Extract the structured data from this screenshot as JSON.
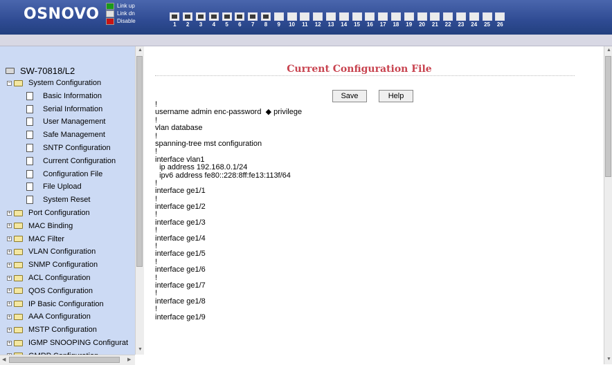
{
  "header": {
    "logo": "OSNOVO",
    "legend": [
      {
        "label": "Link up",
        "color": "#1a9a1a"
      },
      {
        "label": "Link dn",
        "color": "#e0e0e0"
      },
      {
        "label": "Disable",
        "color": "#c81414"
      }
    ],
    "ports": [
      {
        "label": "1",
        "state": "up"
      },
      {
        "label": "2",
        "state": "up"
      },
      {
        "label": "3",
        "state": "up"
      },
      {
        "label": "4",
        "state": "up"
      },
      {
        "label": "5",
        "state": "up"
      },
      {
        "label": "6",
        "state": "up"
      },
      {
        "label": "7",
        "state": "up"
      },
      {
        "label": "8",
        "state": "up"
      },
      {
        "label": "9",
        "state": "down"
      },
      {
        "label": "10",
        "state": "down"
      },
      {
        "label": "11",
        "state": "down"
      },
      {
        "label": "12",
        "state": "down"
      },
      {
        "label": "13",
        "state": "down"
      },
      {
        "label": "14",
        "state": "down"
      },
      {
        "label": "15",
        "state": "down"
      },
      {
        "label": "16",
        "state": "down"
      },
      {
        "label": "17",
        "state": "down"
      },
      {
        "label": "18",
        "state": "down"
      },
      {
        "label": "19",
        "state": "down"
      },
      {
        "label": "20",
        "state": "down"
      },
      {
        "label": "21",
        "state": "down"
      },
      {
        "label": "22",
        "state": "down"
      },
      {
        "label": "23",
        "state": "down"
      },
      {
        "label": "24",
        "state": "down"
      },
      {
        "label": "25",
        "state": "down"
      },
      {
        "label": "26",
        "state": "down"
      }
    ]
  },
  "sidebar": {
    "root": "SW-70818/L2",
    "items": [
      {
        "label": "System Configuration",
        "type": "folder-open",
        "level": 0
      },
      {
        "label": "Basic Information",
        "type": "doc",
        "level": 1
      },
      {
        "label": "Serial Information",
        "type": "doc",
        "level": 1
      },
      {
        "label": "User Management",
        "type": "doc",
        "level": 1
      },
      {
        "label": "Safe Management",
        "type": "doc",
        "level": 1
      },
      {
        "label": "SNTP Configuration",
        "type": "doc",
        "level": 1
      },
      {
        "label": "Current Configuration",
        "type": "doc",
        "level": 1
      },
      {
        "label": "Configuration File",
        "type": "doc",
        "level": 1
      },
      {
        "label": "File Upload",
        "type": "doc",
        "level": 1
      },
      {
        "label": "System Reset",
        "type": "doc",
        "level": 1
      },
      {
        "label": "Port Configuration",
        "type": "folder",
        "level": 0
      },
      {
        "label": "MAC Binding",
        "type": "folder",
        "level": 0
      },
      {
        "label": "MAC Filter",
        "type": "folder",
        "level": 0
      },
      {
        "label": "VLAN Configuration",
        "type": "folder",
        "level": 0
      },
      {
        "label": "SNMP Configuration",
        "type": "folder",
        "level": 0
      },
      {
        "label": "ACL Configuration",
        "type": "folder",
        "level": 0
      },
      {
        "label": "QOS Configuration",
        "type": "folder",
        "level": 0
      },
      {
        "label": "IP Basic Configuration",
        "type": "folder",
        "level": 0
      },
      {
        "label": "AAA Configuration",
        "type": "folder",
        "level": 0
      },
      {
        "label": "MSTP Configuration",
        "type": "folder",
        "level": 0
      },
      {
        "label": "IGMP SNOOPING Configurat",
        "type": "folder",
        "level": 0
      },
      {
        "label": "GMRP Configuration",
        "type": "folder",
        "level": 0
      }
    ]
  },
  "main": {
    "title": "Current Configuration File",
    "save_label": "Save",
    "help_label": "Help",
    "config_lines": [
      "!",
      "username admin enc-password  ◆ privilege",
      "!",
      "vlan database",
      "!",
      "spanning-tree mst configuration",
      "!",
      "interface vlan1",
      "  ip address 192.168.0.1/24",
      "  ipv6 address fe80::228:8ff:fe13:113f/64",
      "!",
      "interface ge1/1",
      "!",
      "interface ge1/2",
      "!",
      "interface ge1/3",
      "!",
      "interface ge1/4",
      "!",
      "interface ge1/5",
      "!",
      "interface ge1/6",
      "!",
      "interface ge1/7",
      "!",
      "interface ge1/8",
      "!",
      "interface ge1/9"
    ]
  }
}
